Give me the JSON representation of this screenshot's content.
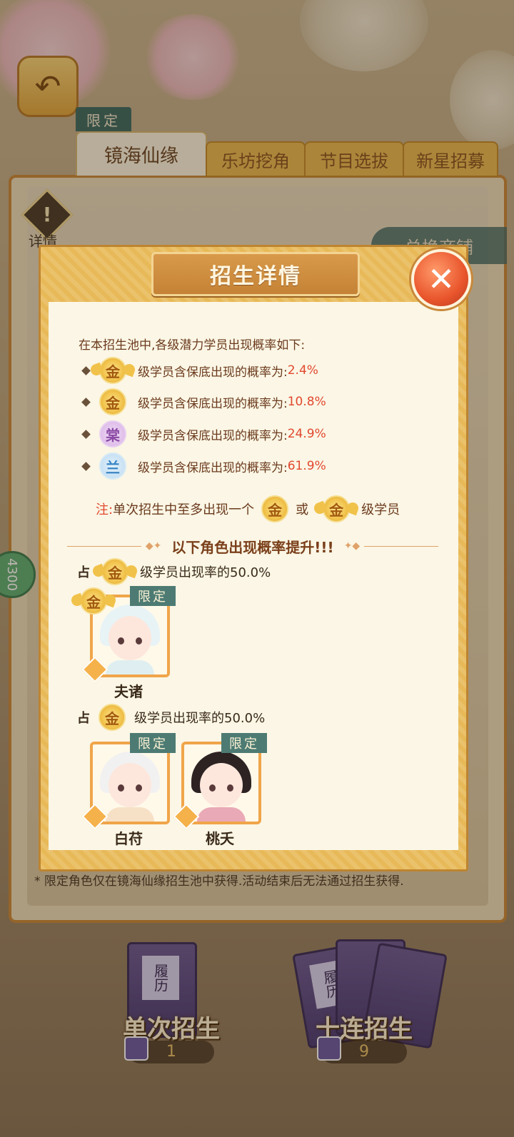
{
  "background": {
    "back_icon": "back-arrow-icon",
    "detail_label": "详情",
    "tabs": {
      "limited_tag": "限定",
      "active": "镜海仙缘",
      "others": [
        "乐坊挖角",
        "节目选拔",
        "新星招募"
      ]
    },
    "shop_button": "兑换商铺",
    "side_badge": "4300",
    "footnote": "* 限定角色仅在镜海仙缘招生池中获得.活动结束后无法通过招生获得.",
    "pulls": [
      {
        "card_label": "履历",
        "title": "单次招生",
        "cost": "1"
      },
      {
        "card_label": "履历",
        "title": "十连招生",
        "cost": "9"
      }
    ]
  },
  "modal": {
    "title": "招生详情",
    "close_icon": "close-x-icon",
    "intro": "在本招生池中,各级潜力学员出现概率如下:",
    "rates": [
      {
        "tier": "金",
        "style": "gold-winged",
        "text": "级学员含保底出现的概率为:",
        "value": "2.4%"
      },
      {
        "tier": "金",
        "style": "gold",
        "text": "级学员含保底出现的概率为:",
        "value": "10.8%"
      },
      {
        "tier": "棠",
        "style": "purple",
        "text": "级学员含保底出现的概率为:",
        "value": "24.9%"
      },
      {
        "tier": "兰",
        "style": "blue",
        "text": "级学员含保底出现的概率为:",
        "value": "61.9%"
      }
    ],
    "note": {
      "prefix": "注:",
      "text1": "单次招生中至多出现一个",
      "tier1": "金",
      "or": "或",
      "tier2": "金",
      "text2": "级学员"
    },
    "divider_text": "以下角色出现概率提升!!!",
    "boost_groups": [
      {
        "prefix": "占",
        "tier": "金",
        "suffix": "级学员出现率的50.0%",
        "characters": [
          {
            "name": "夫诸",
            "limited": "限定",
            "tier": "金"
          }
        ]
      },
      {
        "prefix": "占",
        "tier": "金",
        "suffix": "级学员出现率的50.0%",
        "characters": [
          {
            "name": "白苻",
            "limited": "限定"
          },
          {
            "name": "桃夭",
            "limited": "限定"
          }
        ]
      }
    ]
  },
  "colors": {
    "accent_red": "#e2482f",
    "gold": "#f1c24a",
    "panel": "#fbf6e5",
    "frame": "#e8b958"
  }
}
